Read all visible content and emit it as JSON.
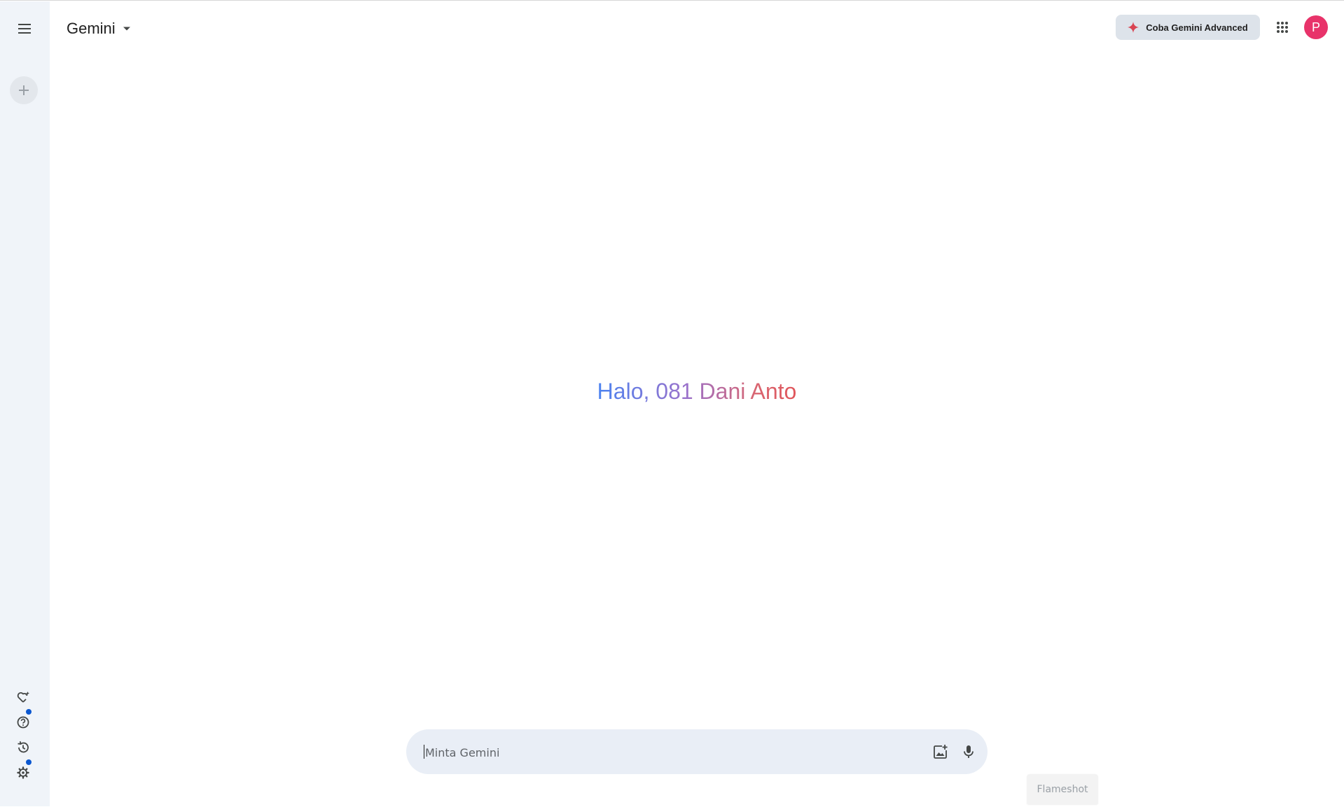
{
  "header": {
    "title": "Gemini",
    "advanced_button_label": "Coba Gemini Advanced",
    "avatar_initial": "P"
  },
  "main": {
    "greeting": "Halo, 081 Dani Anto"
  },
  "prompt": {
    "placeholder": "Minta Gemini"
  },
  "overlay": {
    "flameshot_label": "Flameshot"
  },
  "sidebar": {
    "icons": [
      "menu-icon",
      "plus-icon",
      "gem-manager-icon",
      "help-icon",
      "activity-icon",
      "settings-icon"
    ]
  },
  "colors": {
    "rail_bg": "#f0f4f9",
    "prompt_bg": "#e9eef6",
    "avatar_bg": "#e8336a",
    "notification_dot": "#0b57d0",
    "greeting_gradient": [
      "#4b83f0",
      "#9b72cb",
      "#d96570"
    ]
  }
}
